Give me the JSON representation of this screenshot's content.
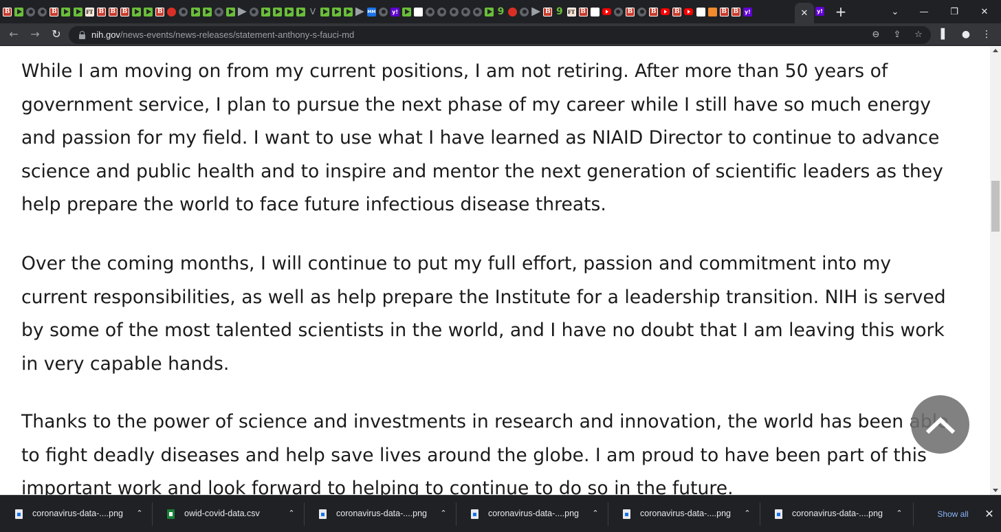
{
  "browser": {
    "tab_icons": [
      "bi",
      "gp",
      "gr",
      "gr",
      "bi",
      "gp",
      "gp",
      "ft",
      "bi",
      "bi",
      "bi",
      "gp",
      "gp",
      "bi",
      "rd",
      "gr",
      "gp",
      "gp",
      "gr",
      "gp",
      "gy",
      "gr",
      "gp",
      "gp",
      "gp",
      "gp",
      "vv",
      "gp",
      "gp",
      "gp",
      "gy",
      "ab",
      "gr",
      "yh",
      "gp",
      "wh",
      "gr",
      "gr",
      "gr",
      "gr",
      "gr",
      "gp",
      "g9",
      "rd",
      "gr",
      "gy",
      "bi",
      "g9",
      "ft",
      "bi",
      "wh",
      "yt",
      "gr",
      "bi",
      "gr",
      "bi",
      "yt",
      "bi",
      "yt",
      "wh",
      "or",
      "bi",
      "bi",
      "yh"
    ],
    "active_tab_close": "✕",
    "other_tab_icon": "y!",
    "new_tab": "+",
    "window_controls": {
      "tab_search": "⌄",
      "minimize": "—",
      "restore": "❐",
      "close": "✕"
    },
    "nav": {
      "back": "←",
      "forward": "→",
      "reload": "↻"
    },
    "url_domain": "nih.gov",
    "url_path": "/news-events/news-releases/statement-anthony-s-fauci-md",
    "omnibox_icons": {
      "zoom": "⊖",
      "share": "⇪",
      "bookmark": "☆"
    },
    "toolbar_right": {
      "side_panel": "▌",
      "profile": "●",
      "menu": "⋮"
    }
  },
  "article": {
    "paragraphs": [
      {
        "lines": [
          "While I am moving on from my current positions, I am not retiring. After more than 50 years of",
          "government service, I plan to pursue the next phase of my career while I still have so much energy",
          "and passion for my field. I want to use what I have learned as NIAID Director to continue to advance",
          "science and public health and to inspire and mentor the next generation of scientific leaders as they",
          "help prepare the world to face future infectious disease threats."
        ]
      },
      {
        "lines": [
          "Over the coming months, I will continue to put my full effort, passion and commitment into my",
          "current responsibilities, as well as help prepare the Institute for a leadership transition. NIH is served",
          "by some of the most talented scientists in the world, and I have no doubt that I am leaving this work",
          "in very capable hands."
        ]
      },
      {
        "lines": [
          "Thanks to the power of science and investments in research and innovation, the world has been able",
          "to fight deadly diseases and help save lives around the globe. I am proud to have been part of this",
          "important work and look forward to helping to continue to do so in the future."
        ]
      }
    ]
  },
  "scrollbar": {
    "scroll_fraction": 0.3
  },
  "downloads": {
    "items": [
      {
        "name": "coronavirus-data-....png",
        "type": "png"
      },
      {
        "name": "owid-covid-data.csv",
        "type": "csv"
      },
      {
        "name": "coronavirus-data-....png",
        "type": "png"
      },
      {
        "name": "coronavirus-data-....png",
        "type": "png"
      },
      {
        "name": "coronavirus-data-....png",
        "type": "png"
      },
      {
        "name": "coronavirus-data-....png",
        "type": "png"
      }
    ],
    "chevron": "⌃",
    "show_all": "Show all",
    "close": "✕"
  }
}
